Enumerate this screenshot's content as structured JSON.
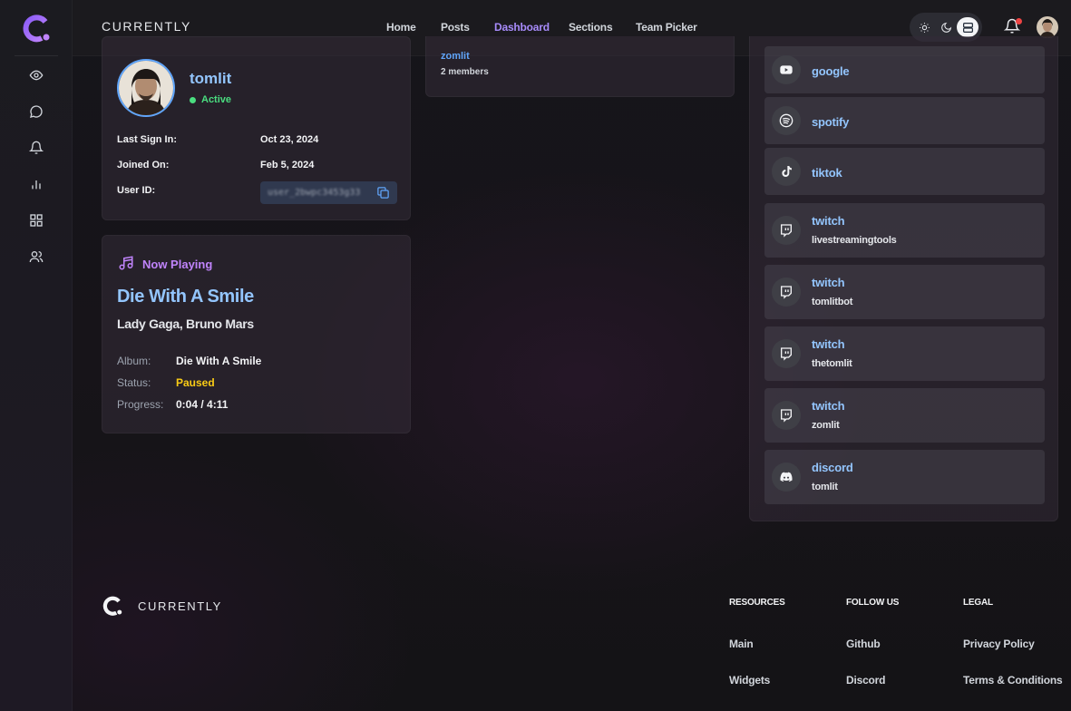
{
  "app": {
    "brand": "CURRENTLY"
  },
  "colors": {
    "accent": "#a78bfa",
    "link": "#93c5fd",
    "status_active": "#4ade80",
    "status_paused": "#facc15",
    "notification": "#ef4444"
  },
  "sidebar": {
    "items": [
      {
        "icon": "eye-icon"
      },
      {
        "icon": "chat-icon"
      },
      {
        "icon": "bell-icon"
      },
      {
        "icon": "chart-icon"
      },
      {
        "icon": "grid-icon"
      },
      {
        "icon": "users-icon"
      }
    ]
  },
  "nav": {
    "links": [
      "Home",
      "Posts",
      "Dashboard",
      "Sections",
      "Team Picker"
    ],
    "active": "Dashboard",
    "theme_options": [
      "sun-icon",
      "moon-icon",
      "system-icon"
    ],
    "theme_selected": "system-icon"
  },
  "profile": {
    "username": "tomlit",
    "status": "Active",
    "last_sign_in_label": "Last Sign In:",
    "last_sign_in_value": "Oct 23, 2024",
    "joined_label": "Joined On:",
    "joined_value": "Feb 5, 2024",
    "user_id_label": "User ID:",
    "user_id_value": "user_2bwpc3453g33"
  },
  "now_playing": {
    "heading": "Now Playing",
    "title": "Die With A Smile",
    "artist": "Lady Gaga, Bruno Mars",
    "album_label": "Album:",
    "album_value": "Die With A Smile",
    "status_label": "Status:",
    "status_value": "Paused",
    "progress_label": "Progress:",
    "progress_value": "0:04 / 4:11"
  },
  "team": {
    "name": "zomlit",
    "members": "2 members"
  },
  "connections": [
    {
      "name": "google",
      "sub": "",
      "icon": "youtube-icon"
    },
    {
      "name": "spotify",
      "sub": "",
      "icon": "spotify-icon"
    },
    {
      "name": "tiktok",
      "sub": "",
      "icon": "tiktok-icon"
    },
    {
      "name": "twitch",
      "sub": "livestreamingtools",
      "icon": "twitch-icon"
    },
    {
      "name": "twitch",
      "sub": "tomlitbot",
      "icon": "twitch-icon"
    },
    {
      "name": "twitch",
      "sub": "thetomlit",
      "icon": "twitch-icon"
    },
    {
      "name": "twitch",
      "sub": "zomlit",
      "icon": "twitch-icon"
    },
    {
      "name": "discord",
      "sub": "tomlit",
      "icon": "discord-icon"
    }
  ],
  "footer": {
    "brand": "CURRENTLY",
    "resources": {
      "heading": "RESOURCES",
      "links": [
        "Main",
        "Widgets"
      ]
    },
    "follow": {
      "heading": "FOLLOW US",
      "links": [
        "Github",
        "Discord"
      ]
    },
    "legal": {
      "heading": "LEGAL",
      "links": [
        "Privacy Policy",
        "Terms & Conditions"
      ]
    }
  }
}
